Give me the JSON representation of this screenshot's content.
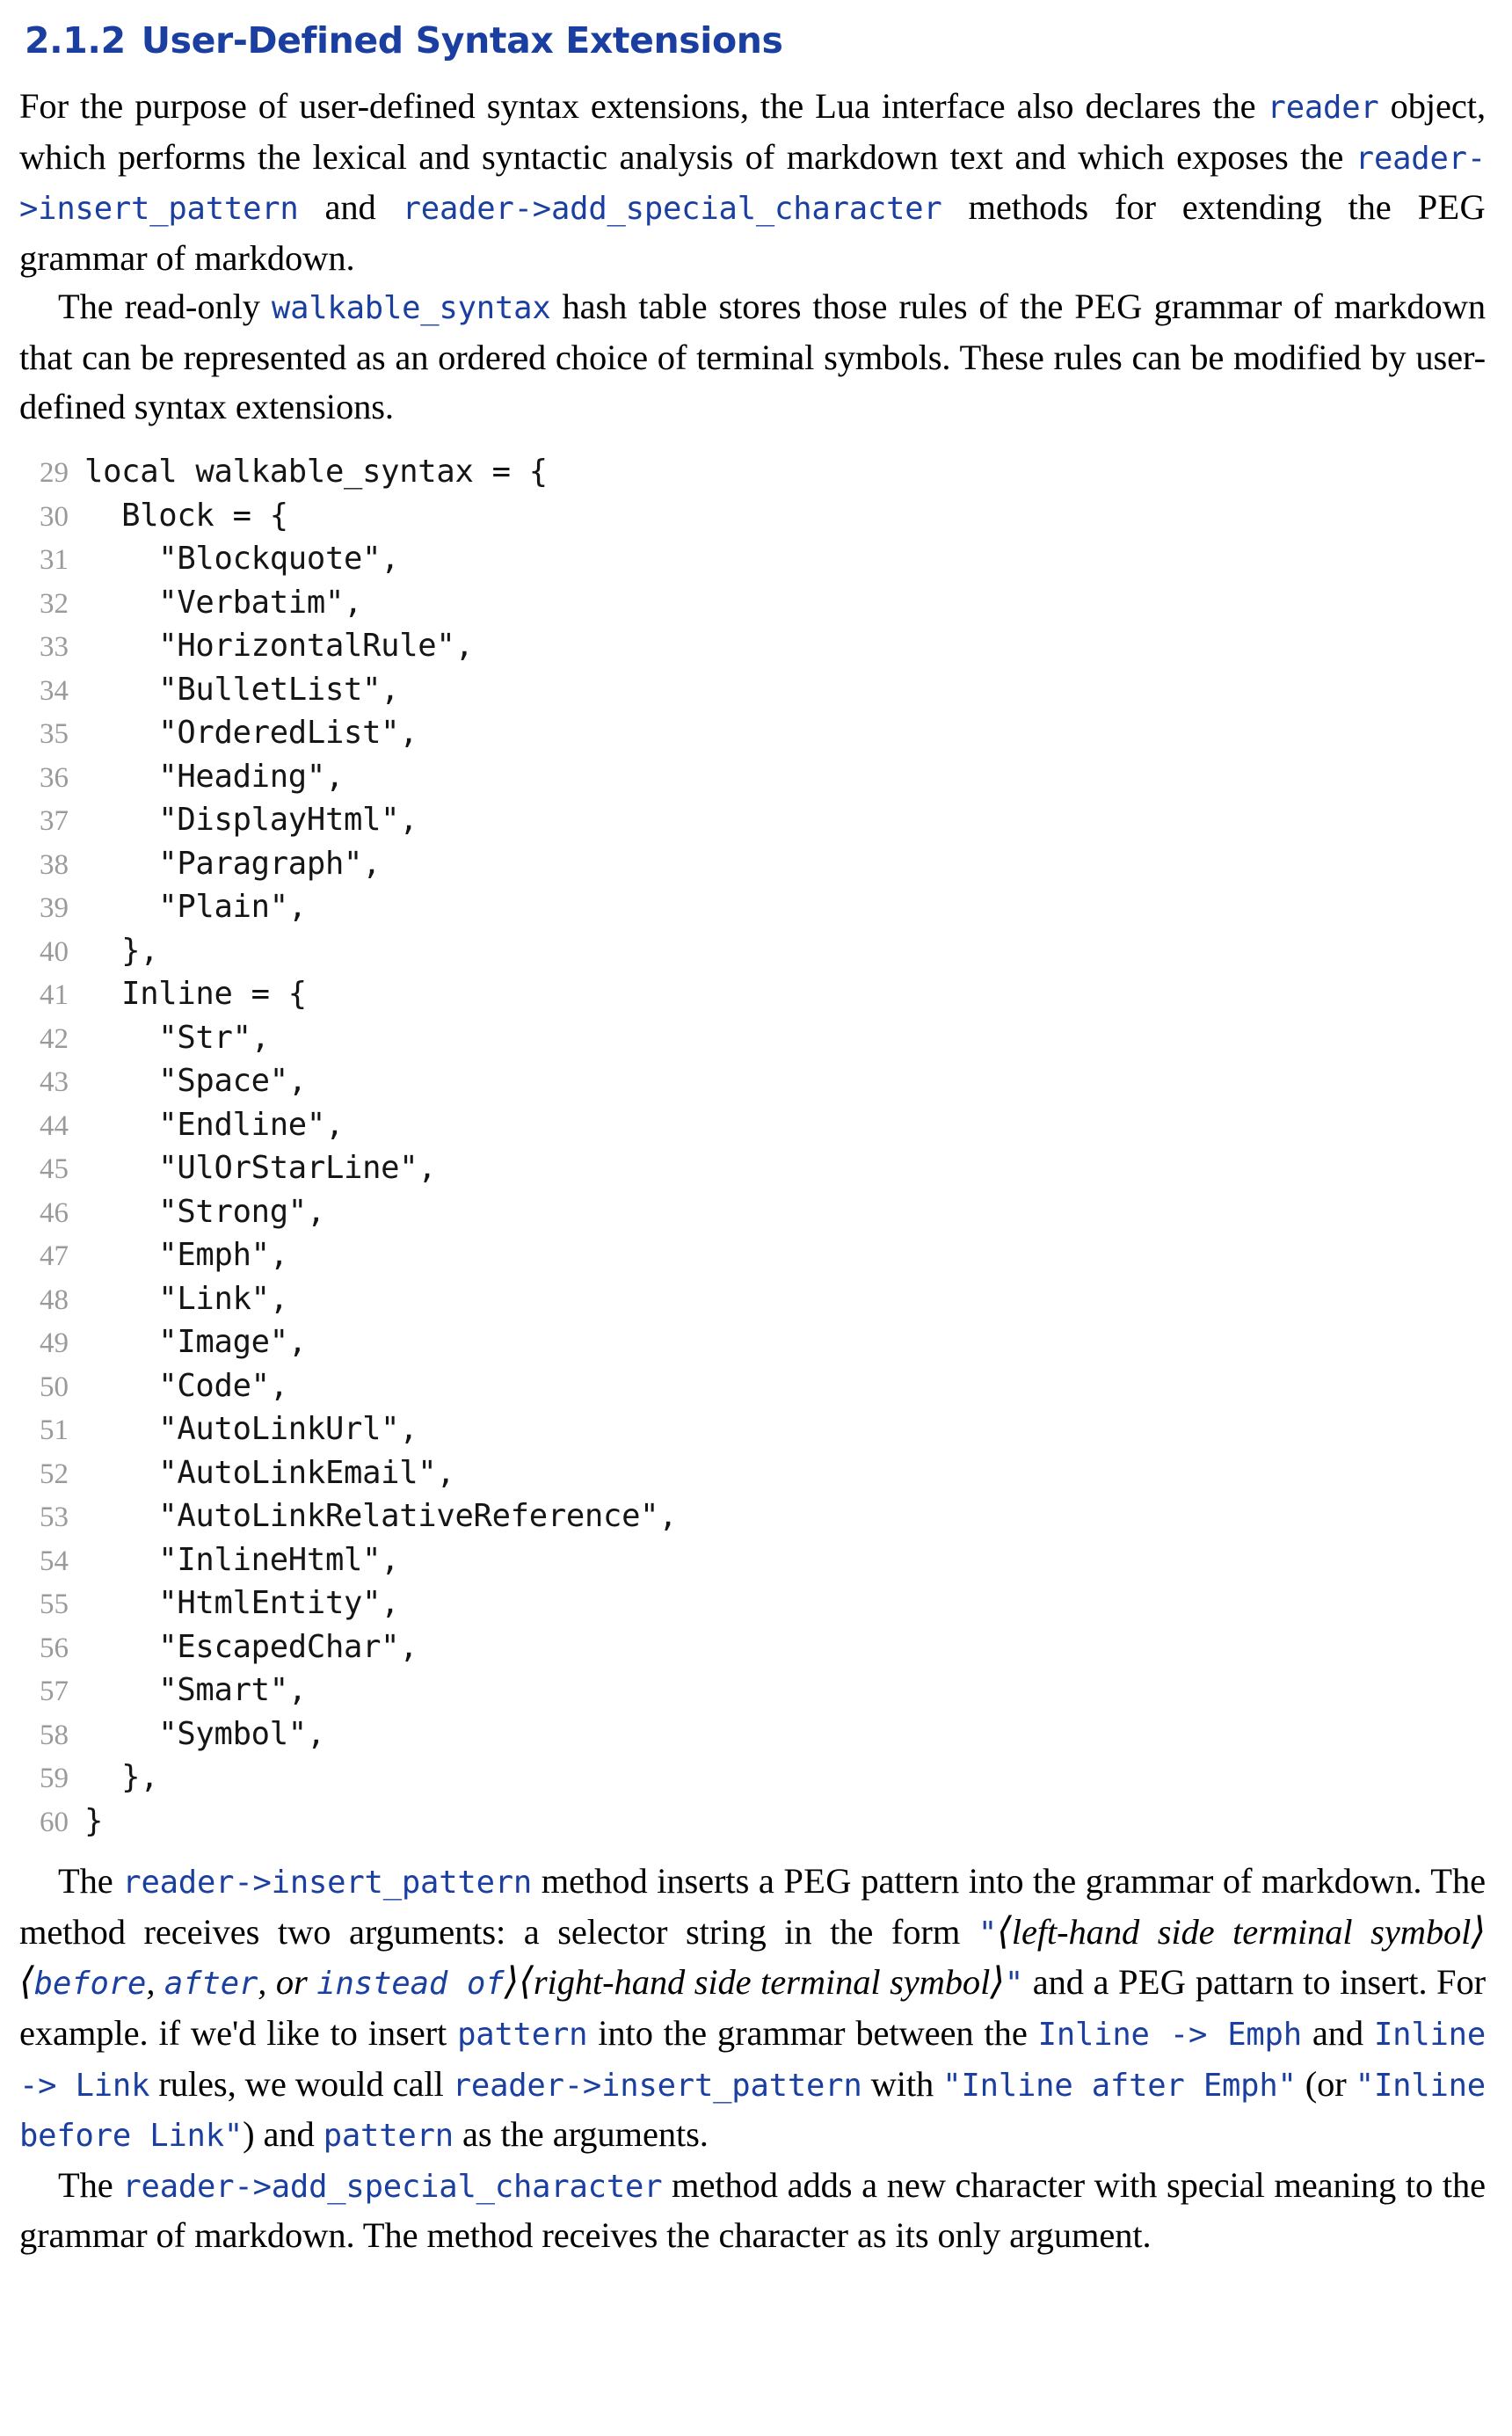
{
  "heading": {
    "number": "2.1.2",
    "title": "User-Defined Syntax Extensions",
    "color": "#1a3fa0"
  },
  "paragraphs": {
    "p1": {
      "seg1": "For the purpose of user-defined syntax extensions, the Lua interface also declares the ",
      "code1": "reader",
      "seg2": " object, which performs the lexical and syntactic analysis of markdown text and which exposes the ",
      "code2": "reader->insert_pattern",
      "seg3": " and ",
      "code3": "reader->add_special_character",
      "seg4": " methods for extending the ",
      "smallcaps1": "PEG",
      "seg5": " grammar of markdown."
    },
    "p2": {
      "seg1": "The read-only ",
      "code1": "walkable_syntax",
      "seg2": " hash table stores those rules of the ",
      "smallcaps1": "PEG",
      "seg3": " grammar of markdown that can be represented as an ordered choice of terminal symbols. These rules can be modified by user-defined syntax extensions."
    },
    "p3": {
      "seg1": "The ",
      "code1": "reader->insert_pattern",
      "seg2": " method inserts a ",
      "smallcaps1": "PEG",
      "seg3": " pattern into the grammar of markdown. The method receives two arguments: a selector string in the form ",
      "quote_open": "\"",
      "angle_open1": "⟨",
      "ital1": "left-hand side terminal symbol",
      "angle_close1": "⟩",
      "angle_open2": "⟨",
      "codeital1": "before",
      "ital_comma1": ", ",
      "codeital2": "after",
      "ital_or": ", or ",
      "codeital3": "instead of",
      "angle_close2": "⟩",
      "angle_open3": "⟨",
      "ital2": "right-hand side terminal symbol",
      "angle_close3": "⟩",
      "quote_close": "\"",
      "seg4": " and a ",
      "smallcaps2": "PEG",
      "seg5": " pattarn to insert. For example. if we'd like to insert ",
      "code2": "pattern",
      "seg6": " into the grammar between the ",
      "code3": "Inline -> Emph",
      "seg7": " and ",
      "code4": "Inline -> Link",
      "seg8": " rules, we would call ",
      "code5": "reader->insert_pattern",
      "seg9": " with ",
      "code6": "\"Inline after Emph\"",
      "seg10": " (or ",
      "code7": "\"Inline before Link\"",
      "seg11": ") and ",
      "code8": "pattern",
      "seg12": " as the arguments."
    },
    "p4": {
      "seg1": "The ",
      "code1": "reader->add_special_character",
      "seg2": " method adds a new character with special meaning to the grammar of markdown. The method receives the character as its only argument."
    }
  },
  "listing": {
    "language": "lua",
    "line_number_color": "#9a9a9a",
    "lines": [
      {
        "no": "29",
        "src": "local walkable_syntax = {"
      },
      {
        "no": "30",
        "src": "  Block = {"
      },
      {
        "no": "31",
        "src": "    \"Blockquote\","
      },
      {
        "no": "32",
        "src": "    \"Verbatim\","
      },
      {
        "no": "33",
        "src": "    \"HorizontalRule\","
      },
      {
        "no": "34",
        "src": "    \"BulletList\","
      },
      {
        "no": "35",
        "src": "    \"OrderedList\","
      },
      {
        "no": "36",
        "src": "    \"Heading\","
      },
      {
        "no": "37",
        "src": "    \"DisplayHtml\","
      },
      {
        "no": "38",
        "src": "    \"Paragraph\","
      },
      {
        "no": "39",
        "src": "    \"Plain\","
      },
      {
        "no": "40",
        "src": "  },"
      },
      {
        "no": "41",
        "src": "  Inline = {"
      },
      {
        "no": "42",
        "src": "    \"Str\","
      },
      {
        "no": "43",
        "src": "    \"Space\","
      },
      {
        "no": "44",
        "src": "    \"Endline\","
      },
      {
        "no": "45",
        "src": "    \"UlOrStarLine\","
      },
      {
        "no": "46",
        "src": "    \"Strong\","
      },
      {
        "no": "47",
        "src": "    \"Emph\","
      },
      {
        "no": "48",
        "src": "    \"Link\","
      },
      {
        "no": "49",
        "src": "    \"Image\","
      },
      {
        "no": "50",
        "src": "    \"Code\","
      },
      {
        "no": "51",
        "src": "    \"AutoLinkUrl\","
      },
      {
        "no": "52",
        "src": "    \"AutoLinkEmail\","
      },
      {
        "no": "53",
        "src": "    \"AutoLinkRelativeReference\","
      },
      {
        "no": "54",
        "src": "    \"InlineHtml\","
      },
      {
        "no": "55",
        "src": "    \"HtmlEntity\","
      },
      {
        "no": "56",
        "src": "    \"EscapedChar\","
      },
      {
        "no": "57",
        "src": "    \"Smart\","
      },
      {
        "no": "58",
        "src": "    \"Symbol\","
      },
      {
        "no": "59",
        "src": "  },"
      },
      {
        "no": "60",
        "src": "}"
      }
    ]
  }
}
